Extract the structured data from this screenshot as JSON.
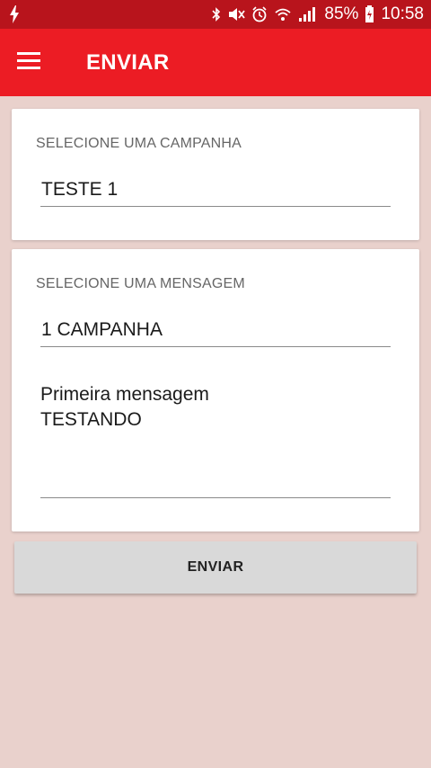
{
  "status_bar": {
    "battery": "85%",
    "time": "10:58",
    "icons": [
      "flash-icon",
      "bluetooth-icon",
      "mute-icon",
      "alarm-icon",
      "wifi-icon",
      "signal-icon",
      "battery-icon"
    ]
  },
  "app_bar": {
    "title": "ENVIAR",
    "menu_icon": "menu-icon"
  },
  "campaign_card": {
    "label": "SELECIONE UMA CAMPANHA",
    "value": "TESTE 1"
  },
  "message_card": {
    "label": "SELECIONE UMA MENSAGEM",
    "value": "1 CAMPANHA",
    "text": "Primeira mensagem\nTESTANDO"
  },
  "send_button": {
    "label": "ENVIAR"
  },
  "colors": {
    "status_bar": "#b8141c",
    "app_bar": "#ec1c24",
    "background": "#e9d1cc",
    "button": "#d9d9d9"
  }
}
